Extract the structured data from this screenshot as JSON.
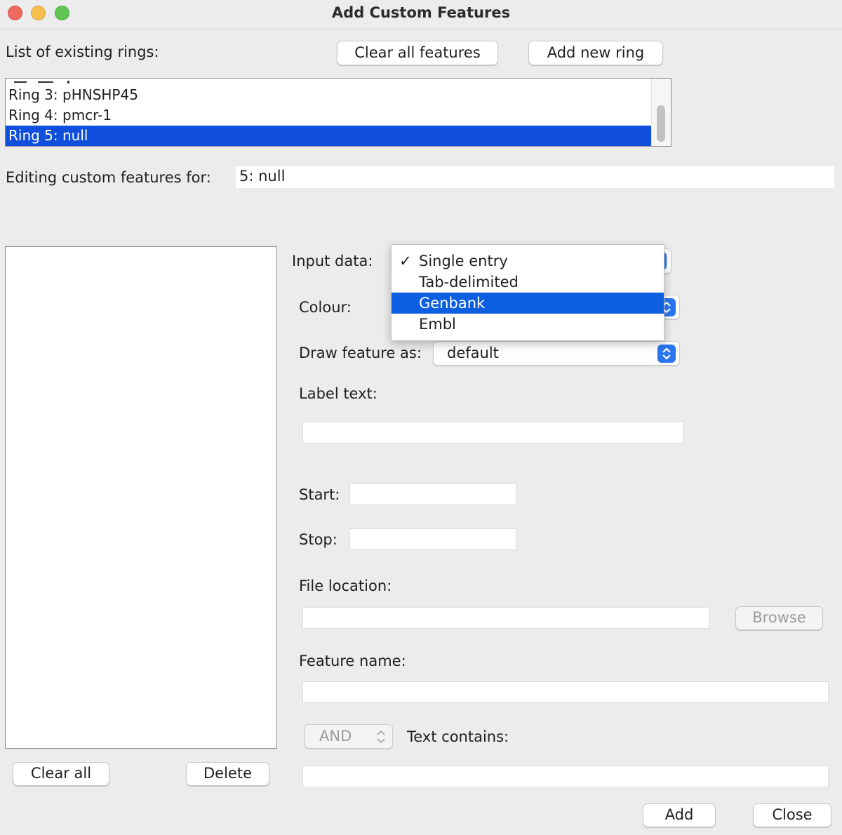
{
  "window": {
    "title": "Add Custom Features"
  },
  "rings": {
    "label": "List of existing rings:",
    "clear_all_features": "Clear all features",
    "add_new_ring": "Add new ring",
    "items": [
      "Ring 3: pHNSHP45",
      "Ring 4: pmcr-1",
      "Ring 5: null"
    ],
    "selected": "Ring 5: null"
  },
  "editing": {
    "label": "Editing custom features for:",
    "value": "5: null"
  },
  "form": {
    "input_data_label": "Input data:",
    "input_data_options": [
      "Single entry",
      "Tab-delimited",
      "Genbank",
      "Embl"
    ],
    "input_data_checked": "Single entry",
    "input_data_highlighted": "Genbank",
    "check_mark": "✓",
    "colour_label": "Colour:",
    "draw_as_label": "Draw feature as:",
    "draw_as_value": "default",
    "label_text_label": "Label text:",
    "label_text_value": "",
    "start_label": "Start:",
    "start_value": "",
    "stop_label": "Stop:",
    "stop_value": "",
    "file_location_label": "File location:",
    "file_location_value": "",
    "browse_label": "Browse",
    "feature_name_label": "Feature name:",
    "feature_name_value": "",
    "logic_value": "AND",
    "text_contains_label": "Text contains:",
    "text_contains_value": ""
  },
  "left_buttons": {
    "clear_all": "Clear all",
    "delete": "Delete"
  },
  "footer": {
    "add": "Add",
    "close": "Close"
  },
  "colors": {
    "selection": "#0f4fdc",
    "menu_highlight": "#0b5fe0",
    "accent": "#2a76f0"
  }
}
